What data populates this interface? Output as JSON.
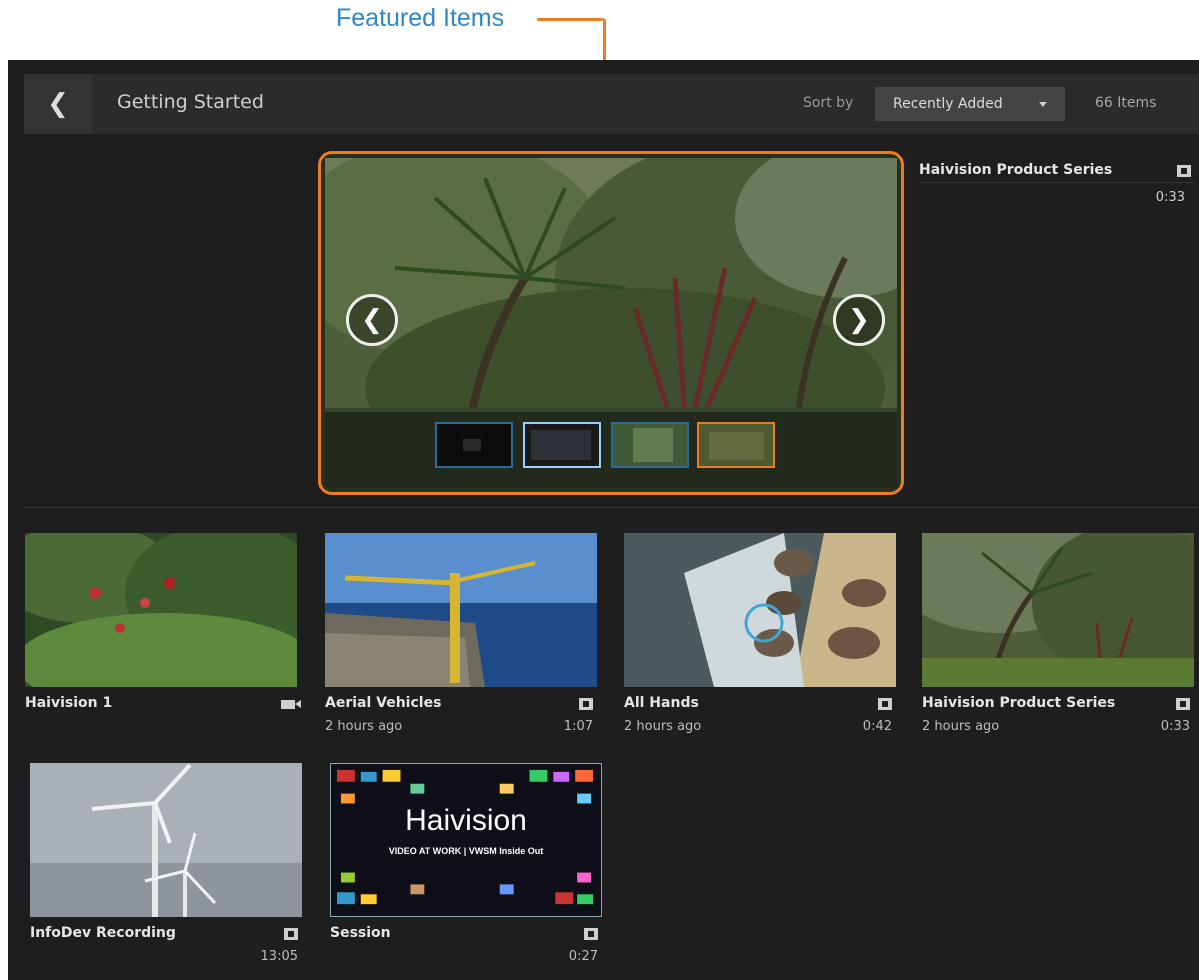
{
  "callout": {
    "label": "Featured Items"
  },
  "header": {
    "title": "Getting Started",
    "sort_label": "Sort by",
    "sort_value": "Recently Added",
    "items_count": "66 Items"
  },
  "featured_side": {
    "title": "Haivision Product Series",
    "duration": "0:33"
  },
  "tiles": [
    {
      "title": "Haivision 1",
      "age": "",
      "duration": "",
      "icon": "camera-icon"
    },
    {
      "title": "Aerial Vehicles",
      "age": "2 hours ago",
      "duration": "1:07",
      "icon": "film-icon"
    },
    {
      "title": "All Hands",
      "age": "2 hours ago",
      "duration": "0:42",
      "icon": "film-icon"
    },
    {
      "title": "Haivision Product Series",
      "age": "2 hours ago",
      "duration": "0:33",
      "icon": "film-icon"
    },
    {
      "title": "InfoDev Recording",
      "age": "",
      "duration": "13:05",
      "icon": "film-icon"
    },
    {
      "title": "Session",
      "age": "",
      "duration": "0:27",
      "icon": "film-icon"
    }
  ],
  "session_thumb": {
    "brand": "Haivision",
    "tagline": "VIDEO AT WORK | VWSM Inside Out"
  },
  "colors": {
    "accent": "#f07c22",
    "callout_text": "#2f86c8",
    "background": "#1e1e1e"
  }
}
